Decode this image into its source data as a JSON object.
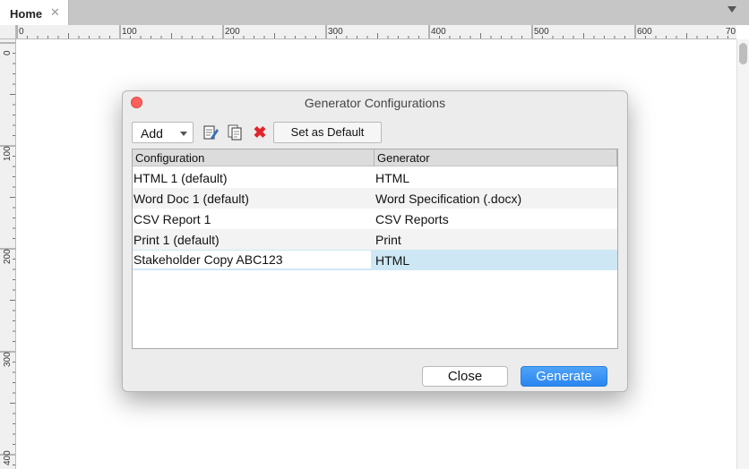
{
  "tab": {
    "label": "Home",
    "close_glyph": "✕"
  },
  "ruler": {
    "horizontal_labels": [
      "0",
      "100",
      "200",
      "300",
      "400",
      "500",
      "600",
      "70"
    ],
    "vertical_labels": [
      "0",
      "100",
      "200",
      "300",
      "400"
    ]
  },
  "dialog": {
    "title": "Generator Configurations",
    "toolbar": {
      "add_label": "Add",
      "icons": [
        "edit-icon",
        "copy-icon",
        "delete-icon"
      ],
      "delete_glyph": "✖",
      "set_default_label": "Set as Default"
    },
    "table": {
      "headers": {
        "configuration": "Configuration",
        "generator": "Generator"
      },
      "rows": [
        {
          "configuration": "HTML 1 (default)",
          "generator": "HTML"
        },
        {
          "configuration": "Word Doc 1 (default)",
          "generator": "Word Specification (.docx)"
        },
        {
          "configuration": "CSV Report 1",
          "generator": "CSV Reports"
        },
        {
          "configuration": "Print 1 (default)",
          "generator": "Print"
        },
        {
          "configuration": "Stakeholder Copy ABC123",
          "generator": "HTML"
        }
      ],
      "editing_row_index": 4
    },
    "buttons": {
      "close": "Close",
      "generate": "Generate"
    }
  },
  "colors": {
    "selection": "#cde8f4",
    "primary_button": "#2a86f1",
    "delete_icon": "#e0252b",
    "window_close": "#fc605b"
  }
}
